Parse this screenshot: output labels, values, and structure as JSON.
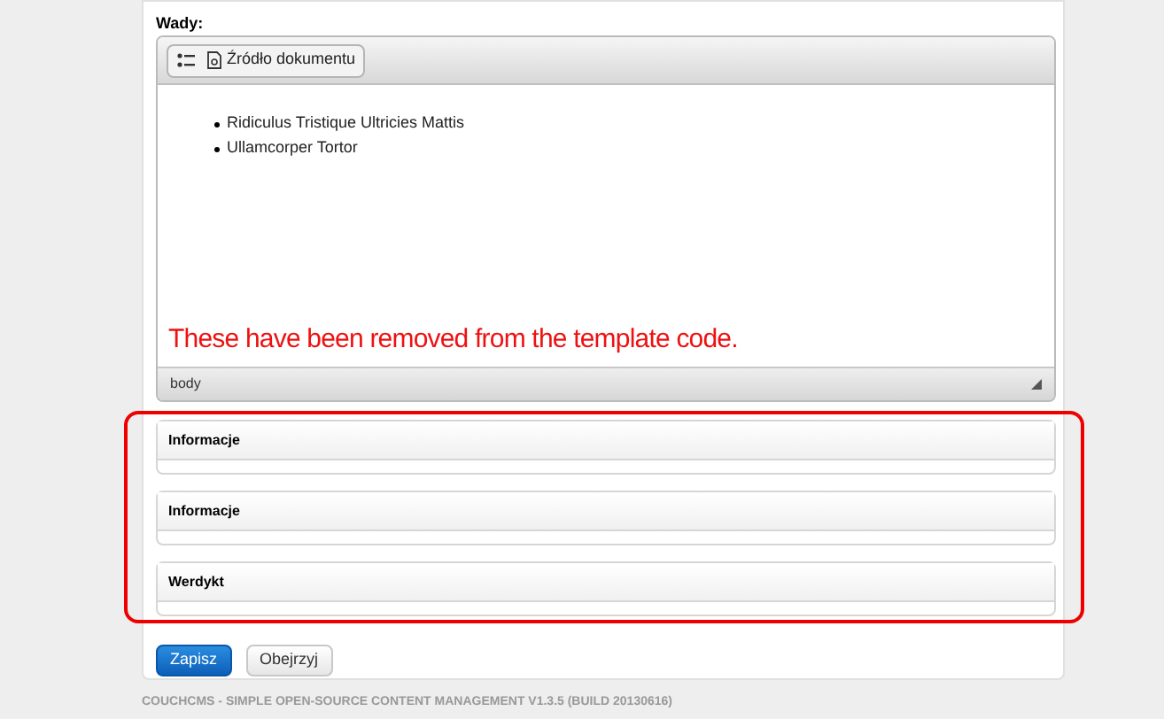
{
  "field_label": "Wady:",
  "editor": {
    "toolbar": [
      {
        "kind": "list"
      },
      {
        "kind": "source",
        "label": "Źródło dokumentu"
      }
    ],
    "items": [
      "Ridiculus Tristique Ultricies Mattis",
      "Ullamcorper Tortor"
    ],
    "annotation": "These have been removed from the template code.",
    "path": "body"
  },
  "sections": [
    {
      "title": "Informacje"
    },
    {
      "title": "Informacje"
    },
    {
      "title": "Werdykt"
    }
  ],
  "buttons": [
    {
      "label": "Zapisz",
      "kind": "primary"
    },
    {
      "label": "Obejrzyj",
      "kind": "secondary"
    }
  ],
  "footer": "COUCHCMS - SIMPLE OPEN-SOURCE CONTENT MANAGEMENT V1.3.5 (BUILD 20130616)"
}
